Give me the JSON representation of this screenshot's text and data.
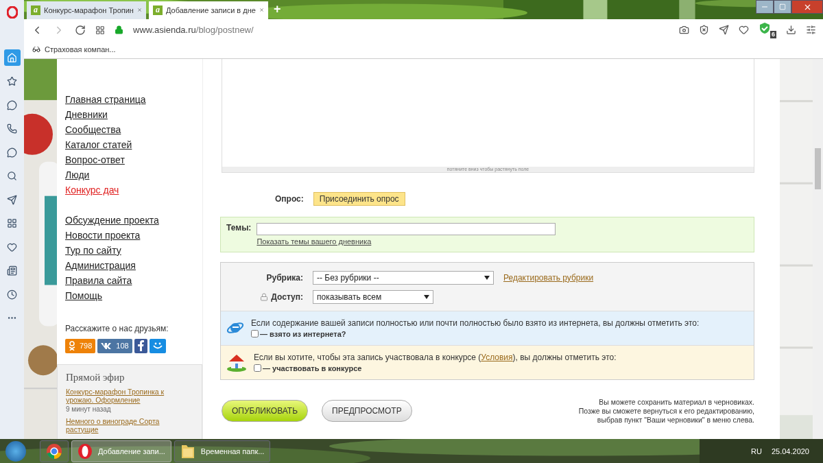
{
  "browser": {
    "tabs": [
      {
        "favicon": "a",
        "title": "Конкурс-марафон Тропин",
        "selected": false
      },
      {
        "favicon": "a",
        "title": "Добавление записи в дне",
        "selected": true
      }
    ],
    "new_tab": "+",
    "url_domain": "www.asienda.ru",
    "url_path": "/blog/postnew/",
    "bookmarks": [
      "Страховая компан..."
    ],
    "adblock_count": "6"
  },
  "nav": {
    "main": [
      {
        "label": "Главная страница",
        "highlight": false
      },
      {
        "label": "Дневники",
        "highlight": false
      },
      {
        "label": "Сообщества",
        "highlight": false
      },
      {
        "label": "Каталог статей",
        "highlight": false
      },
      {
        "label": "Вопрос-ответ",
        "highlight": false
      },
      {
        "label": "Люди",
        "highlight": false
      },
      {
        "label": "Конкурс дач",
        "highlight": true
      }
    ],
    "project": [
      {
        "label": "Обсуждение проекта",
        "highlight": false
      },
      {
        "label": "Новости проекта",
        "highlight": false
      },
      {
        "label": "Тур по сайту",
        "highlight": false
      },
      {
        "label": "Администрация",
        "highlight": false
      },
      {
        "label": "Правила сайта",
        "highlight": false
      },
      {
        "label": "Помощь",
        "highlight": false
      }
    ]
  },
  "share": {
    "title": "Расскажите о нас друзьям:",
    "buttons": [
      {
        "kind": "ok",
        "count": "798"
      },
      {
        "kind": "vk",
        "count": "108"
      },
      {
        "kind": "fb"
      },
      {
        "kind": "mm"
      }
    ]
  },
  "live": {
    "title": "Прямой эфир",
    "items": [
      {
        "link": "Конкурс-марафон Тропинка к урожаю. Оформление",
        "time": "9 минут назад"
      },
      {
        "link": "Немного о винограде Сорта растущие"
      }
    ]
  },
  "editor": {
    "resize_hint": "потяните вниз чтобы растянуть поле"
  },
  "poll": {
    "label": "Опрос:",
    "button": "Присоединить опрос"
  },
  "topics": {
    "label": "Темы:",
    "link": "Показать темы вашего дневника"
  },
  "rubric": {
    "label": "Рубрика:",
    "value": "-- Без рубрики --",
    "link": "Редактировать рубрики"
  },
  "access": {
    "label": "Доступ:",
    "value": "показывать всем"
  },
  "internet": {
    "text": "Если содержание вашей записи полностью или почти полностью было взято из интернета, вы должны отметить это:",
    "checkbox": "— взято из интернета?",
    "checked": false
  },
  "contest": {
    "text_before": "Если вы хотите, чтобы эта запись участвовала в конкурсе (",
    "link": "Условия",
    "text_after": "), вы должны отметить это:",
    "checkbox": "— участвовать в конкурсе",
    "checked": false
  },
  "actions": {
    "publish": "ОПУБЛИКОВАТЬ",
    "preview": "ПРЕДПРОСМОТР",
    "note": [
      "Вы можете сохранить материал в черновиках.",
      "Позже вы сможете вернуться к его редактированию,",
      "выбрав пункт \"Ваши черновики\" в меню слева."
    ]
  },
  "taskbar": {
    "apps": [
      {
        "kind": "chrome",
        "selected": false
      },
      {
        "kind": "opera",
        "label": "Добавление запи...",
        "selected": true
      },
      {
        "kind": "folder",
        "label": "Временная папк...",
        "selected": false
      }
    ],
    "lang": "RU",
    "date": "25.04.2020"
  }
}
